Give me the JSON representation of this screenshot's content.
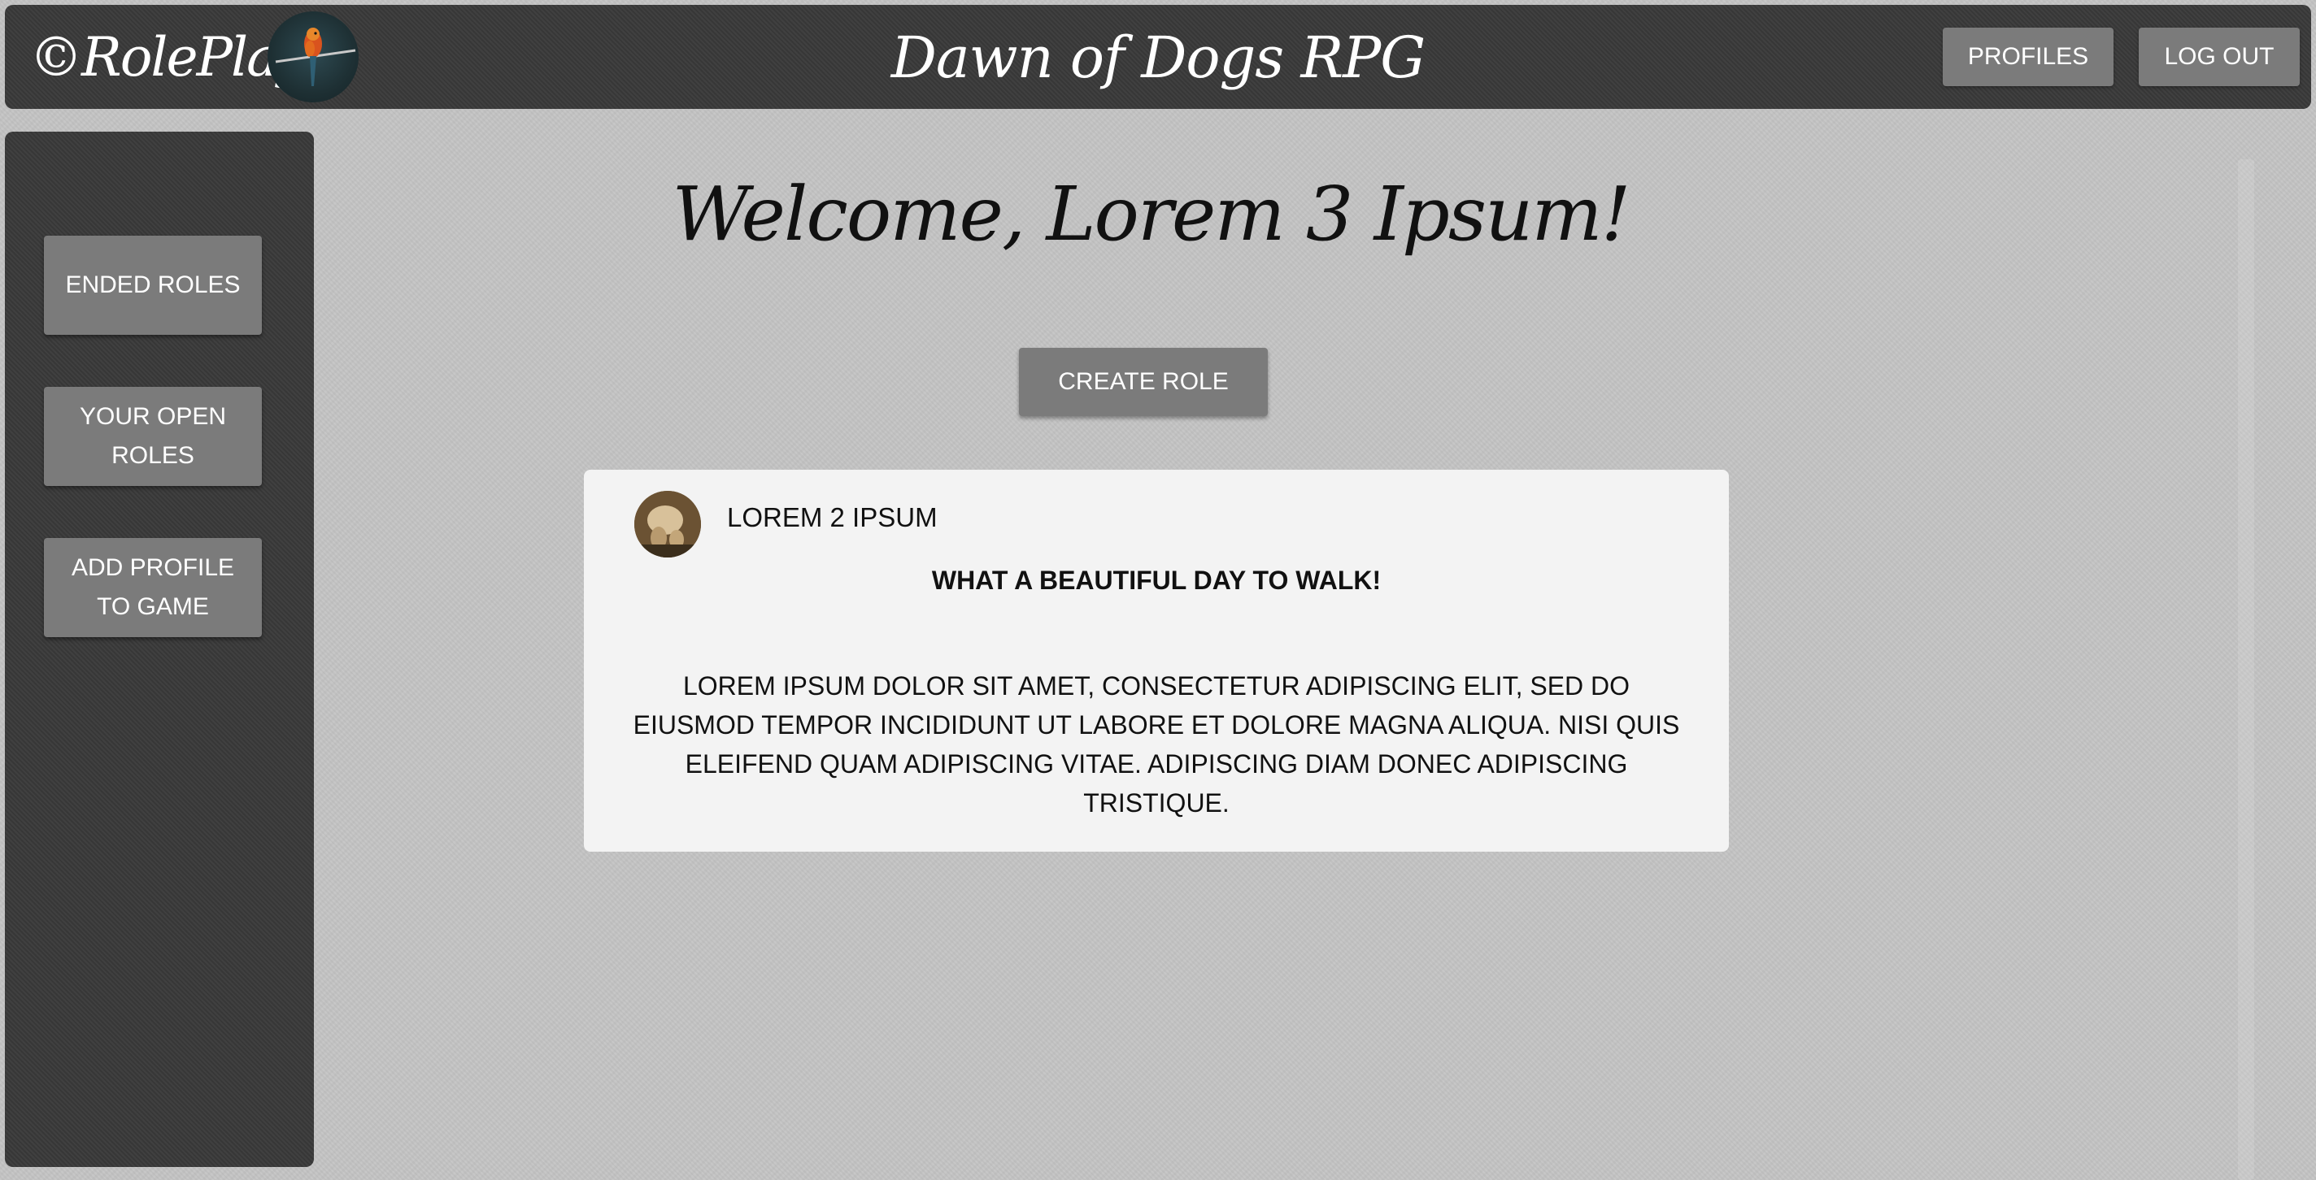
{
  "header": {
    "brand": "©RolePlay",
    "title": "Dawn of Dogs RPG",
    "profiles_label": "PROFILES",
    "logout_label": "LOG OUT"
  },
  "sidebar": {
    "items": [
      {
        "label": "ENDED ROLES"
      },
      {
        "label": "YOUR OPEN ROLES"
      },
      {
        "label": "ADD PROFILE TO GAME"
      }
    ]
  },
  "main": {
    "welcome": "Welcome, Lorem 3 Ipsum!",
    "create_label": "CREATE ROLE",
    "post": {
      "author": "LOREM 2 IPSUM",
      "title": "WHAT A BEAUTIFUL DAY TO WALK!",
      "body": "LOREM IPSUM DOLOR SIT AMET, CONSECTETUR ADIPISCING ELIT, SED DO EIUSMOD TEMPOR INCIDIDUNT UT LABORE ET DOLORE MAGNA ALIQUA. NISI QUIS ELEIFEND QUAM ADIPISCING VITAE. ADIPISCING DIAM DONEC ADIPISCING TRISTIQUE."
    }
  },
  "icons": {
    "brand_logo": "bird-on-branch-logo",
    "post_avatar": "dog-avatar"
  }
}
